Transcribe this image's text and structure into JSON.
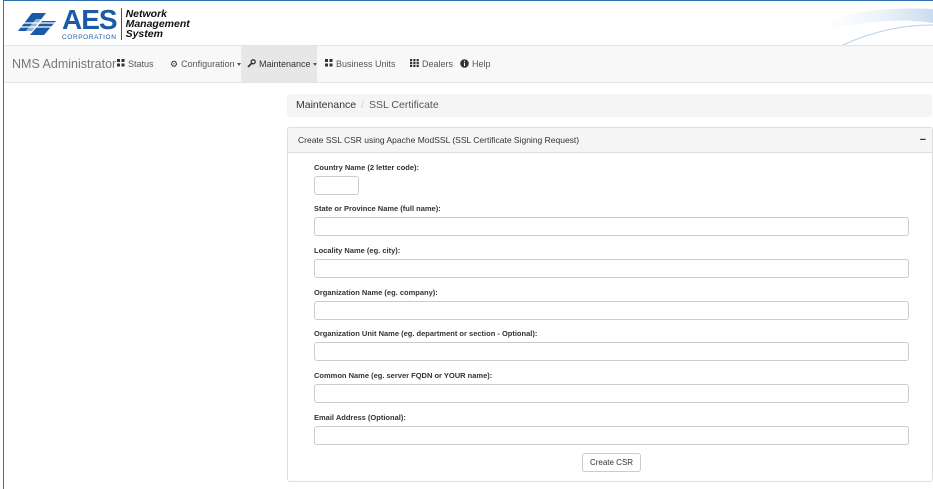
{
  "header": {
    "logo_name": "AES",
    "logo_corp": "CORPORATION",
    "system_line1": "Network",
    "system_line2": "Management",
    "system_line3": "System"
  },
  "navbar": {
    "brand": "NMS Administrator",
    "items": [
      {
        "label": "Status",
        "icon": "grid-icon",
        "dropdown": false,
        "active": false
      },
      {
        "label": "Configuration",
        "icon": "gear-icon",
        "dropdown": true,
        "active": false
      },
      {
        "label": "Maintenance",
        "icon": "wrench-icon",
        "dropdown": true,
        "active": true
      },
      {
        "label": "Business Units",
        "icon": "grid-icon",
        "dropdown": false,
        "active": false
      },
      {
        "label": "Dealers",
        "icon": "list-grid-icon",
        "dropdown": false,
        "active": false
      },
      {
        "label": "Help",
        "icon": "info-icon",
        "dropdown": false,
        "active": false
      }
    ]
  },
  "breadcrumb": {
    "items": [
      "Maintenance",
      "SSL Certificate"
    ],
    "separator": "/"
  },
  "panel": {
    "title": "Create SSL CSR using Apache ModSSL (SSL Certificate Signing Request)",
    "collapse_symbol": "−",
    "fields": [
      {
        "label": "Country Name (2 letter code):",
        "value": "",
        "placeholder": ""
      },
      {
        "label": "State or Province Name (full name):",
        "value": "",
        "placeholder": ""
      },
      {
        "label": "Locality Name (eg. city):",
        "value": "",
        "placeholder": ""
      },
      {
        "label": "Organization Name (eg. company):",
        "value": "",
        "placeholder": ""
      },
      {
        "label": "Organization Unit Name (eg. department or section - Optional):",
        "value": "",
        "placeholder": ""
      },
      {
        "label": "Common Name (eg. server FQDN or YOUR name):",
        "value": "",
        "placeholder": ""
      },
      {
        "label": "Email Address (Optional):",
        "value": "",
        "placeholder": ""
      }
    ],
    "submit_label": "Create CSR"
  },
  "colors": {
    "brand_blue": "#1a5aa6",
    "navbar_bg": "#f8f8f8",
    "active_nav_bg": "#e7e7e7",
    "panel_heading_bg": "#f5f5f5"
  }
}
